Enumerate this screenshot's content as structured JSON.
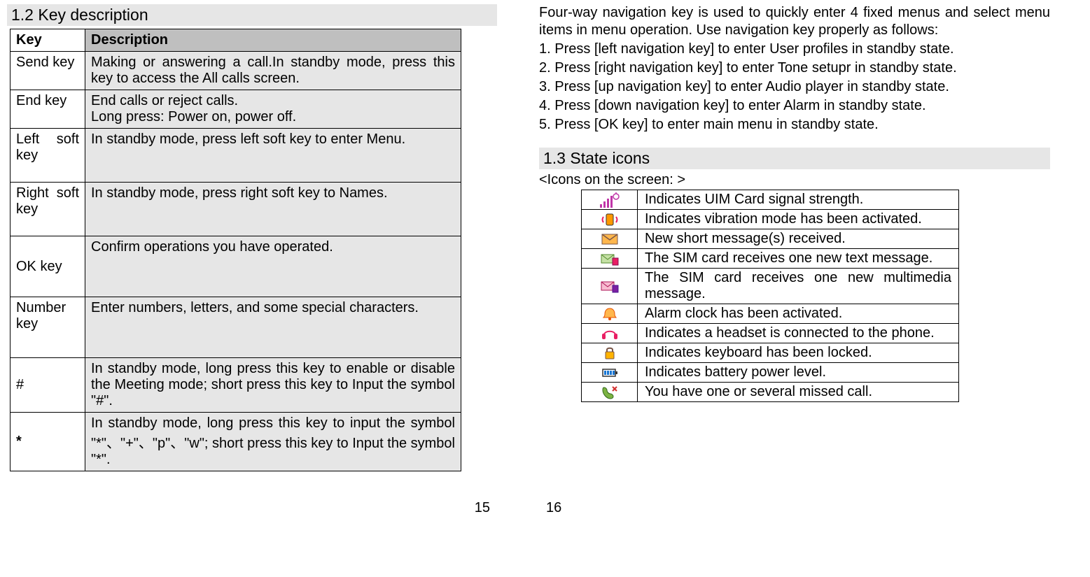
{
  "left": {
    "section_heading": "1.2 Key description",
    "table": {
      "header_key": "Key",
      "header_desc": "Description",
      "rows": [
        {
          "key": "Send key",
          "desc": "Making or answering a call.In standby mode, press this key to access the All calls screen."
        },
        {
          "key": "End key",
          "desc": "End calls or reject calls.\nLong press: Power on, power off."
        },
        {
          "key": "Left soft key",
          "desc": "In standby mode, press left soft key to enter Menu."
        },
        {
          "key": "Right soft key",
          "desc": "In standby mode, press right soft key to Names."
        },
        {
          "key": "OK key",
          "desc": "Confirm operations you have operated."
        },
        {
          "key": "Number key",
          "desc": "Enter numbers, letters, and some special characters."
        },
        {
          "key": "#",
          "desc": "In standby mode, long press this key to enable or disable the Meeting mode; short press this key to Input the symbol \"#\"."
        },
        {
          "key": "*",
          "desc": "In standby mode, long press this key to input the symbol \"*\"、\"+\"、\"p\"、\"w\"; short press this key to Input the symbol \"*\"."
        }
      ]
    },
    "page_number": "15"
  },
  "right": {
    "intro": "Four-way navigation key is used to quickly enter 4 fixed menus and select menu items in menu operation. Use navigation key properly as follows:",
    "nav_items": [
      "1. Press [left navigation key] to enter User profiles in standby state.",
      "2. Press [right navigation key] to enter Tone setupr in standby state.",
      "3. Press [up navigation key] to enter Audio player in standby state.",
      "4. Press [down navigation key] to enter Alarm in standby state.",
      "5. Press [OK key] to enter main menu in standby state."
    ],
    "section_heading": "1.3 State icons",
    "subheader": "<Icons on the screen: >",
    "icons": [
      {
        "name": "signal-icon",
        "desc": "Indicates UIM Card signal strength."
      },
      {
        "name": "vibration-icon",
        "desc": "Indicates vibration mode has been activated."
      },
      {
        "name": "message-icon",
        "desc": "New short message(s) received."
      },
      {
        "name": "sim-text-icon",
        "desc": "The SIM card receives one new text message."
      },
      {
        "name": "sim-mms-icon",
        "desc": "The SIM card receives one new multimedia message."
      },
      {
        "name": "alarm-icon",
        "desc": "Alarm clock has been activated."
      },
      {
        "name": "headset-icon",
        "desc": "Indicates a headset is connected to the phone."
      },
      {
        "name": "lock-icon",
        "desc": "Indicates keyboard has been locked."
      },
      {
        "name": "battery-icon",
        "desc": "Indicates battery power level."
      },
      {
        "name": "missed-call-icon",
        "desc": "You have one or several missed call."
      }
    ],
    "page_number": "16"
  }
}
